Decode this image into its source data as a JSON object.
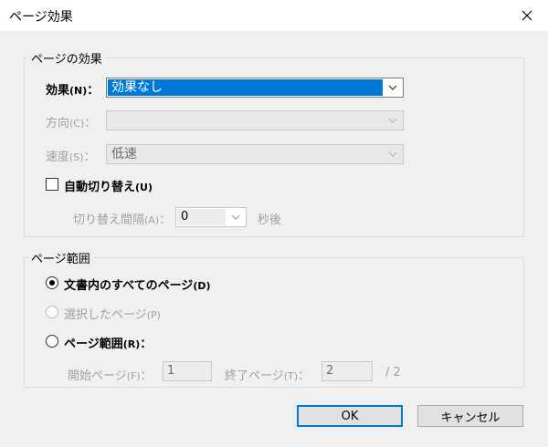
{
  "window": {
    "title": "ページ効果",
    "close_icon": "close-icon"
  },
  "effect_group": {
    "legend": "ページの効果",
    "effect": {
      "label": "効果",
      "accel": "(N)",
      "suffix": "：",
      "value": "効果なし"
    },
    "direction": {
      "label": "方向",
      "accel": "(C)",
      "suffix": "：",
      "value": ""
    },
    "speed": {
      "label": "速度",
      "accel": "(S)",
      "suffix": "：",
      "value": "低速"
    },
    "auto_advance": {
      "label": "自動切り替え",
      "accel": "(U)",
      "checked": false
    },
    "interval": {
      "label": "切り替え間隔",
      "accel": "(A)",
      "suffix": "：",
      "value": "0",
      "unit": "秒後"
    }
  },
  "range_group": {
    "legend": "ページ範囲",
    "all_pages": {
      "label": "文書内のすべてのページ",
      "accel": "(D)",
      "selected": true
    },
    "selected_pages": {
      "label": "選択したページ",
      "accel": "(P)",
      "selected": false
    },
    "page_range": {
      "label": "ページ範囲",
      "accel": "(R)",
      "suffix": "：",
      "selected": false
    },
    "start_page": {
      "label": "開始ページ",
      "accel": "(F)",
      "suffix": "：",
      "value": "1"
    },
    "end_page": {
      "label": "終了ページ",
      "accel": "(T)",
      "suffix": "：",
      "value": "2"
    },
    "total": "/ 2"
  },
  "buttons": {
    "ok": "OK",
    "cancel": "キャンセル"
  },
  "colors": {
    "accent": "#0078d7",
    "disabled_text": "#a0a0a0"
  }
}
